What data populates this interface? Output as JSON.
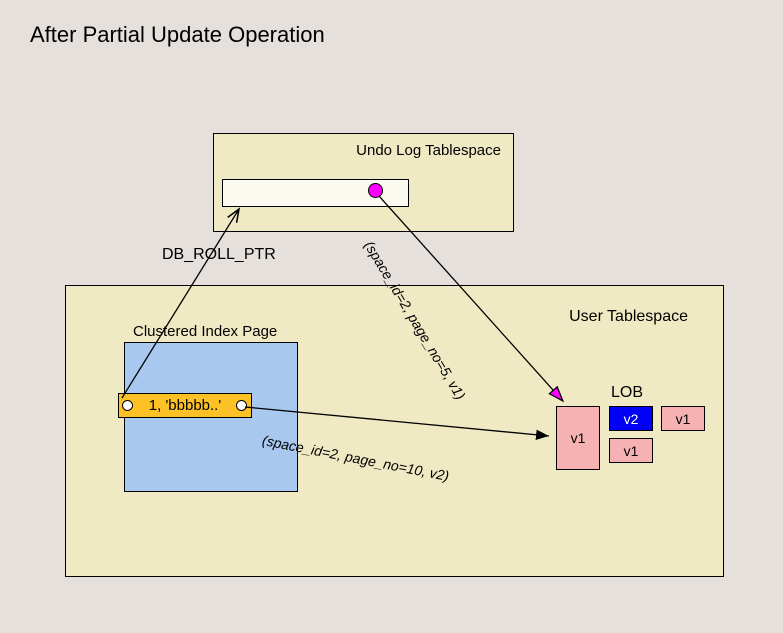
{
  "title": "After Partial Update Operation",
  "undo_log": {
    "label": "Undo Log Tablespace"
  },
  "user_tablespace": {
    "label": "User Tablespace",
    "clustered_index": {
      "label": "Clustered Index Page",
      "row": "1, 'bbbbb..'"
    },
    "lob": {
      "label": "LOB",
      "blocks": {
        "v1_big": "v1",
        "v2": "v2",
        "v1_bottom": "v1",
        "v1_right": "v1"
      }
    }
  },
  "arrows": {
    "db_roll_ptr": "DB_ROLL_PTR",
    "lob_ref_undo": "(space_id=2, page_no=5, v1)",
    "lob_ref_row": "(space_id=2, page_no=10, v2)"
  }
}
